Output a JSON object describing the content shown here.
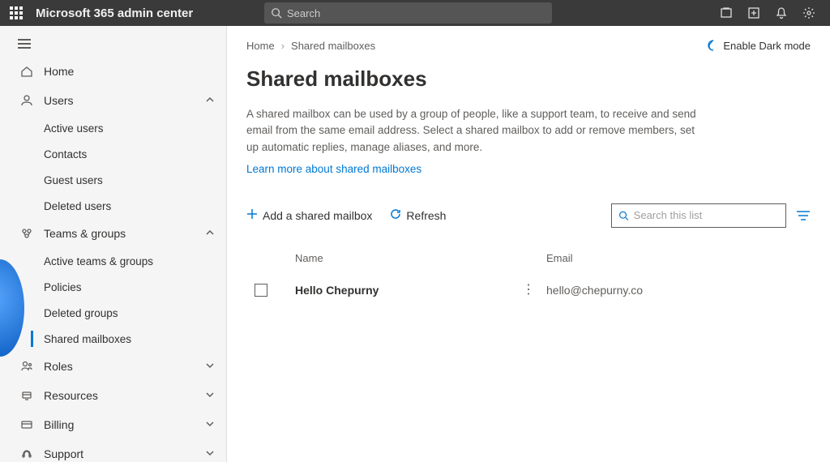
{
  "header": {
    "appTitle": "Microsoft 365 admin center",
    "searchPlaceholder": "Search"
  },
  "sidebar": {
    "home": "Home",
    "users": {
      "label": "Users",
      "items": [
        "Active users",
        "Contacts",
        "Guest users",
        "Deleted users"
      ]
    },
    "teams": {
      "label": "Teams & groups",
      "items": [
        "Active teams & groups",
        "Policies",
        "Deleted groups",
        "Shared mailboxes"
      ]
    },
    "roles": "Roles",
    "resources": "Resources",
    "billing": "Billing",
    "support": "Support"
  },
  "breadcrumb": {
    "home": "Home",
    "current": "Shared mailboxes"
  },
  "darkMode": "Enable Dark mode",
  "page": {
    "title": "Shared mailboxes",
    "description": "A shared mailbox can be used by a group of people, like a support team, to receive and send email from the same email address. Select a shared mailbox to add or remove members, set up automatic replies, manage aliases, and more.",
    "learnMore": "Learn more about shared mailboxes"
  },
  "toolbar": {
    "add": "Add a shared mailbox",
    "refresh": "Refresh",
    "searchPlaceholder": "Search this list"
  },
  "table": {
    "headers": {
      "name": "Name",
      "email": "Email"
    },
    "rows": [
      {
        "name": "Hello Chepurny",
        "email": "hello@chepurny.co"
      }
    ]
  }
}
